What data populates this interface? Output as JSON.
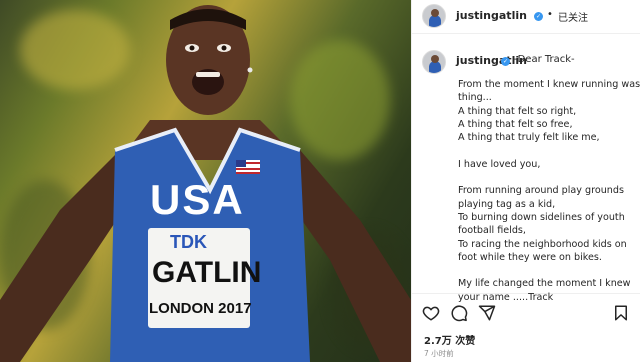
{
  "photo": {
    "jersey_chest_text": "USA",
    "bib_sponsor": "TDK",
    "bib_name": "GATLIN",
    "bib_event": "LONDON 2017",
    "image_description_icon": "athlete-photo"
  },
  "header": {
    "username": "justingatlin",
    "verified_icon": "verified-badge-icon",
    "separator": "•",
    "follow_state": "已关注"
  },
  "caption": {
    "username": "justingatlin",
    "title": "-Dear Track-",
    "paragraphs": [
      [
        "From the moment I knew running was a",
        "thing...",
        "A thing that felt so right,",
        "A thing that felt so free,",
        "A thing that truly felt like me,"
      ],
      [
        "I have loved you,"
      ],
      [
        "From running around play grounds",
        "playing tag as a kid,",
        "To burning down sidelines of youth",
        "football fields,",
        "To racing the neighborhood kids on",
        "foot while they were on bikes."
      ],
      [
        "My life changed the moment I knew",
        "your name .....Track"
      ]
    ]
  },
  "actions": {
    "like_icon": "heart-icon",
    "comment_icon": "comment-icon",
    "share_icon": "paper-plane-icon",
    "save_icon": "bookmark-icon"
  },
  "stats": {
    "likes": "2.7万 次赞",
    "time_ago": "7 小时前"
  },
  "colors": {
    "verified_blue": "#3897f0",
    "jersey_blue": "#2f5fb4",
    "text_primary": "#262626",
    "text_secondary": "#8e8e8e"
  }
}
